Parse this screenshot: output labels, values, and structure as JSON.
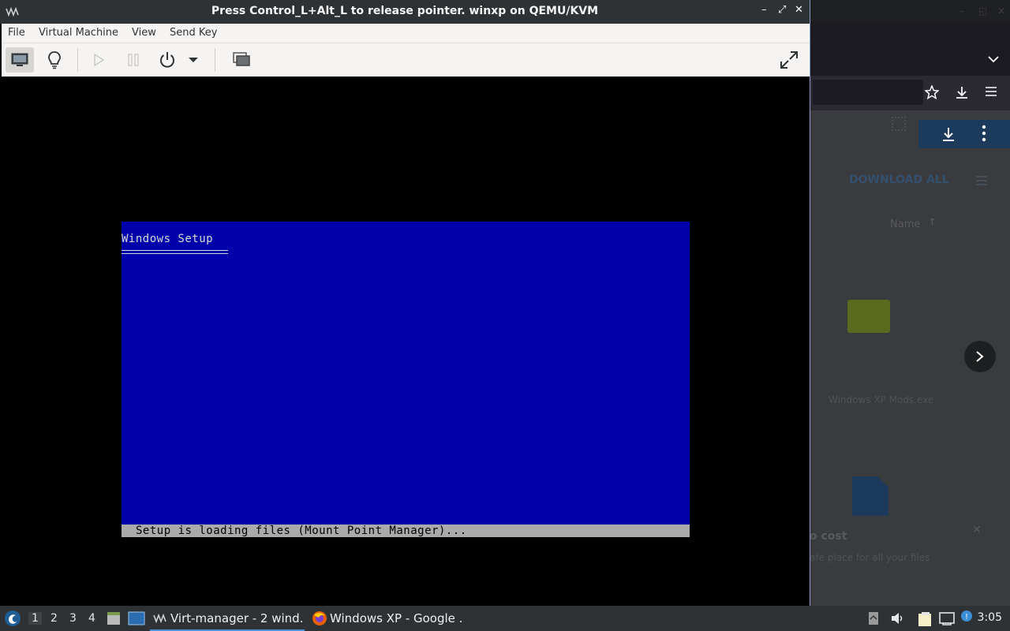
{
  "vm_window": {
    "title": "Press Control_L+Alt_L to release pointer. winxp on QEMU/KVM",
    "menus": [
      "File",
      "Virtual Machine",
      "View",
      "Send Key"
    ]
  },
  "setup_screen": {
    "title": "Windows Setup",
    "status": "Setup is loading files (Mount Point Manager)...",
    "background_color": "#0000aa",
    "status_bar_color": "#aaaaaa"
  },
  "background_browser": {
    "download_all": "DOWNLOAD ALL",
    "name_column": "Name",
    "file_name": "Windows XP Mods.exe",
    "promo_title": "o cost",
    "promo_text": "afe place for all your files"
  },
  "taskbar": {
    "workspaces": [
      "1",
      "2",
      "3",
      "4"
    ],
    "tasks": [
      {
        "label": "Virt-manager - 2 wind..."
      },
      {
        "label": "Windows XP - Google ..."
      }
    ],
    "clock": "3:05"
  }
}
